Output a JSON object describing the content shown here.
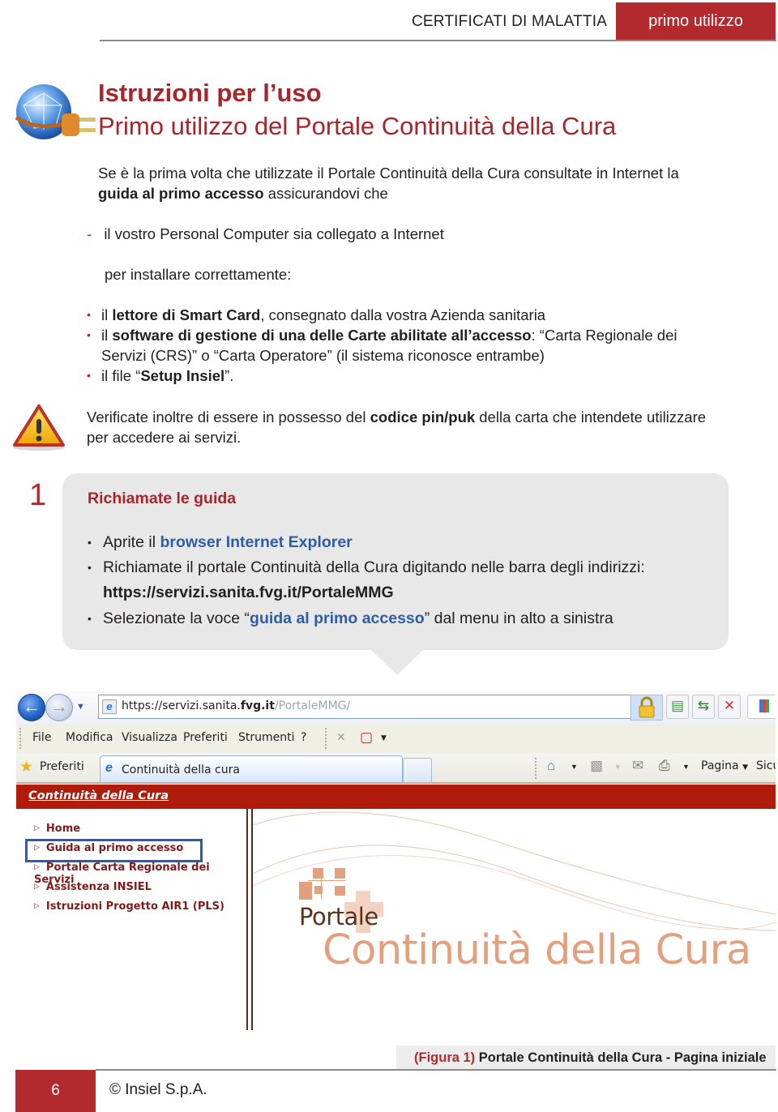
{
  "header": {
    "section_title": "CERTIFICATI DI MALATTIA",
    "badge": "primo utilizzo"
  },
  "titles": {
    "main": "Istruzioni per l’uso",
    "sub": "Primo utilizzo del Portale Continuità della Cura"
  },
  "intro": {
    "line1": "Se è la prima volta che utilizzate il Portale Continuità della Cura consultate in Internet la",
    "line2_bold": "guida al primo accesso",
    "line2_rest": " assicurandovi che"
  },
  "dash_item": {
    "marker": "-",
    "text": "il vostro Personal Computer sia collegato a Internet"
  },
  "install_label": "per installare correttamente:",
  "install_items": [
    {
      "pre": "il ",
      "bold": "lettore di Smart Card",
      "post": ", consegnato dalla vostra Azienda sanitaria"
    },
    {
      "pre": "il ",
      "bold": "software di gestione di una delle Carte abilitate all’accesso",
      "post": ":  “Carta Regionale dei",
      "line2": "Servizi (CRS)” o “Carta Operatore” (il sistema riconosce entrambe)"
    },
    {
      "pre": "il file “",
      "bold": "Setup Insiel",
      "post": "”."
    }
  ],
  "warning": {
    "pre": "Verificate inoltre di essere in possesso del ",
    "bold": "codice pin/puk",
    "post": " della carta che intendete utilizzare",
    "line2": "per accedere ai servizi."
  },
  "step": {
    "number": "1",
    "title": "Richiamate le guida",
    "items": [
      {
        "pre": "Aprite il ",
        "highlight": "browser Internet Explorer",
        "post": ""
      },
      {
        "pre": "Richiamate il portale Continuità della Cura digitando nelle barra degli indirizzi:",
        "url": "https://servizi.sanita.fvg.it/PortaleMMG"
      },
      {
        "pre": "Selezionate la voce “",
        "highlight": "guida al primo accesso",
        "post": "” dal menu in alto a sinistra"
      }
    ]
  },
  "browser": {
    "address_prefix": "https://servizi.sanita.",
    "address_domain": "fvg.it",
    "address_suffix": "/PortaleMMG/",
    "menu": [
      {
        "label": "File",
        "accel": "F"
      },
      {
        "label": "Modifica",
        "accel": "M"
      },
      {
        "label": "Visualizza",
        "accel": "V"
      },
      {
        "label": "Preferiti",
        "accel": "r"
      },
      {
        "label": "Strumenti",
        "accel": "e"
      },
      {
        "label": "?",
        "accel": "?"
      }
    ],
    "favorites_label": "Preferiti",
    "tab_label": "Continuità della cura",
    "command_page": "Pagina",
    "command_safety": "Sicu",
    "site_header": "Continuità della Cura",
    "sidebar_items": [
      "Home",
      "Guida al primo accesso",
      "Portale Carta Regionale dei Servizi",
      "Assistenza INSIEL",
      "Istruzioni Progetto AIR1 (PLS)"
    ],
    "selected_item_index": 1,
    "logo_small": "Portale",
    "logo_big": "Continuità della Cura"
  },
  "caption": {
    "label": "(Figura 1)",
    "text": " Portale Continuità della Cura - Pagina iniziale"
  },
  "footer": {
    "page_number": "6",
    "copyright": "© Insiel S.p.A."
  },
  "colors": {
    "brand_red": "#b2292e",
    "link_blue": "#2e5da8",
    "box_gray": "#e8e8e8",
    "portal_red": "#b11b0c",
    "portal_peach": "#e4a07e"
  }
}
